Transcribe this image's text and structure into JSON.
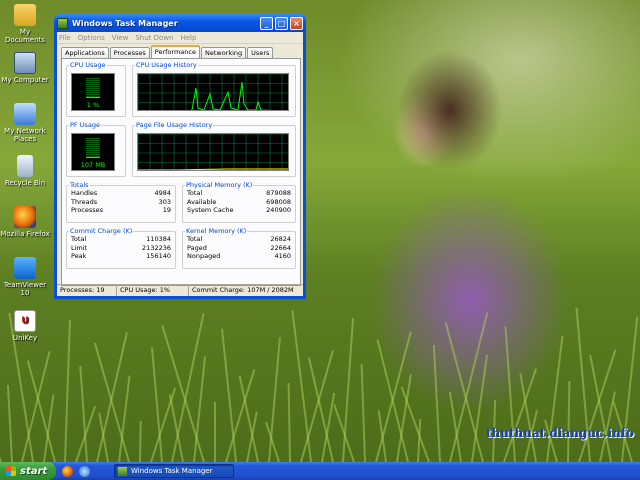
{
  "desktop": {
    "icons": [
      {
        "label": "My Documents",
        "icon": "folder-documents-icon"
      },
      {
        "label": "My Computer",
        "icon": "computer-icon"
      },
      {
        "label": "My Network Places",
        "icon": "network-icon"
      },
      {
        "label": "Recycle Bin",
        "icon": "recycle-bin-icon"
      },
      {
        "label": "Mozilla Firefox",
        "icon": "firefox-icon"
      },
      {
        "label": "TeamViewer 10",
        "icon": "teamviewer-icon"
      },
      {
        "label": "UniKey",
        "icon": "unikey-icon"
      }
    ],
    "watermark": "thuthuat.dianguc.info"
  },
  "window": {
    "title": "Windows Task Manager",
    "menu": [
      "File",
      "Options",
      "View",
      "Shut Down",
      "Help"
    ],
    "tabs": [
      "Applications",
      "Processes",
      "Performance",
      "Networking",
      "Users"
    ],
    "active_tab": "Performance",
    "cpu_usage": {
      "legend": "CPU Usage",
      "value_label": "1 %",
      "level": 0.01
    },
    "cpu_history": {
      "legend": "CPU Usage History"
    },
    "pf_usage": {
      "legend": "PF Usage",
      "value_label": "107 MB",
      "level": 0.05
    },
    "pf_history": {
      "legend": "Page File Usage History"
    },
    "totals": {
      "legend": "Totals",
      "rows": [
        {
          "label": "Handles",
          "value": "4984"
        },
        {
          "label": "Threads",
          "value": "303"
        },
        {
          "label": "Processes",
          "value": "19"
        }
      ]
    },
    "physical_memory": {
      "legend": "Physical Memory (K)",
      "rows": [
        {
          "label": "Total",
          "value": "879088"
        },
        {
          "label": "Available",
          "value": "698008"
        },
        {
          "label": "System Cache",
          "value": "240900"
        }
      ]
    },
    "commit_charge": {
      "legend": "Commit Charge (K)",
      "rows": [
        {
          "label": "Total",
          "value": "110384"
        },
        {
          "label": "Limit",
          "value": "2132236"
        },
        {
          "label": "Peak",
          "value": "156140"
        }
      ]
    },
    "kernel_memory": {
      "legend": "Kernel Memory (K)",
      "rows": [
        {
          "label": "Total",
          "value": "26824"
        },
        {
          "label": "Paged",
          "value": "22664"
        },
        {
          "label": "Nonpaged",
          "value": "4160"
        }
      ]
    },
    "status": {
      "processes": "Processes: 19",
      "cpu": "CPU Usage: 1%",
      "commit": "Commit Charge: 107M / 2082M"
    },
    "colors": {
      "graph_line": "#00ff00",
      "grid": "#008040",
      "title_bar": "#0a58e4"
    }
  },
  "taskbar": {
    "start_label": "start",
    "quick_launch": [
      "firefox-icon",
      "ie-icon"
    ],
    "task_button": "Windows Task Manager"
  }
}
